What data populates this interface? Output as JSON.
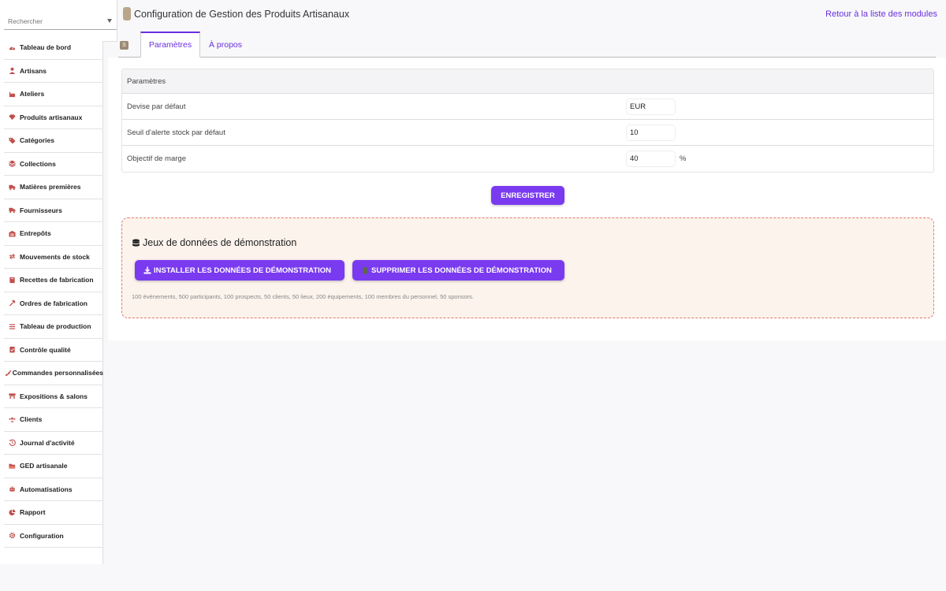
{
  "search": {
    "placeholder": "Rechercher"
  },
  "header": {
    "title": "Configuration de Gestion des Produits Artisanaux",
    "back_link": "Retour à la liste des modules"
  },
  "tabs": [
    {
      "label": "Paramètres",
      "active": true
    },
    {
      "label": "À propos",
      "active": false
    }
  ],
  "sidebar": {
    "items": [
      {
        "label": "Tableau de bord",
        "icon": "gauge-icon"
      },
      {
        "label": "Artisans",
        "icon": "user-icon"
      },
      {
        "label": "Ateliers",
        "icon": "factory-icon"
      },
      {
        "label": "Produits artisanaux",
        "icon": "gem-icon"
      },
      {
        "label": "Catégories",
        "icon": "tags-icon"
      },
      {
        "label": "Collections",
        "icon": "layers-icon"
      },
      {
        "label": "Matières premières",
        "icon": "truck-loading-icon"
      },
      {
        "label": "Fournisseurs",
        "icon": "truck-icon"
      },
      {
        "label": "Entrepôts",
        "icon": "warehouse-icon"
      },
      {
        "label": "Mouvements de stock",
        "icon": "exchange-icon"
      },
      {
        "label": "Recettes de fabrication",
        "icon": "book-icon"
      },
      {
        "label": "Ordres de fabrication",
        "icon": "hammer-icon"
      },
      {
        "label": "Tableau de production",
        "icon": "list-icon"
      },
      {
        "label": "Contrôle qualité",
        "icon": "clipboard-check-icon"
      },
      {
        "label": "Commandes personnalisées",
        "icon": "brush-icon"
      },
      {
        "label": "Expositions & salons",
        "icon": "booth-icon"
      },
      {
        "label": "Clients",
        "icon": "users-icon"
      },
      {
        "label": "Journal d'activité",
        "icon": "history-icon"
      },
      {
        "label": "GED artisanale",
        "icon": "folder-open-icon"
      },
      {
        "label": "Automatisations",
        "icon": "robot-icon"
      },
      {
        "label": "Rapport",
        "icon": "pie-chart-icon"
      },
      {
        "label": "Configuration",
        "icon": "gear-icon"
      }
    ]
  },
  "params": {
    "header": "Paramètres",
    "rows": [
      {
        "label": "Devise par défaut",
        "value": "EUR",
        "suffix": ""
      },
      {
        "label": "Seuil d'alerte stock par défaut",
        "value": "10",
        "suffix": ""
      },
      {
        "label": "Objectif de marge",
        "value": "40",
        "suffix": "%"
      }
    ],
    "save_label": "ENREGISTRER"
  },
  "demo": {
    "title": "Jeux de données de démonstration",
    "install_label": "INSTALLER LES DONNÉES DE DÉMONSTRATION",
    "delete_label": "SUPPRIMER LES DONNÉES DE DÉMONSTRATION",
    "description": "100 événements, 500 participants, 100 prospects, 50 clients, 50 lieux, 200 équipements, 100 membres du personnel, 50 sponsors."
  },
  "colors": {
    "accent": "#7a3af0",
    "link": "#6b2fe0",
    "icon": "#c0504d",
    "demo_bg": "#fbf3ec",
    "demo_border": "#e07a6a"
  }
}
